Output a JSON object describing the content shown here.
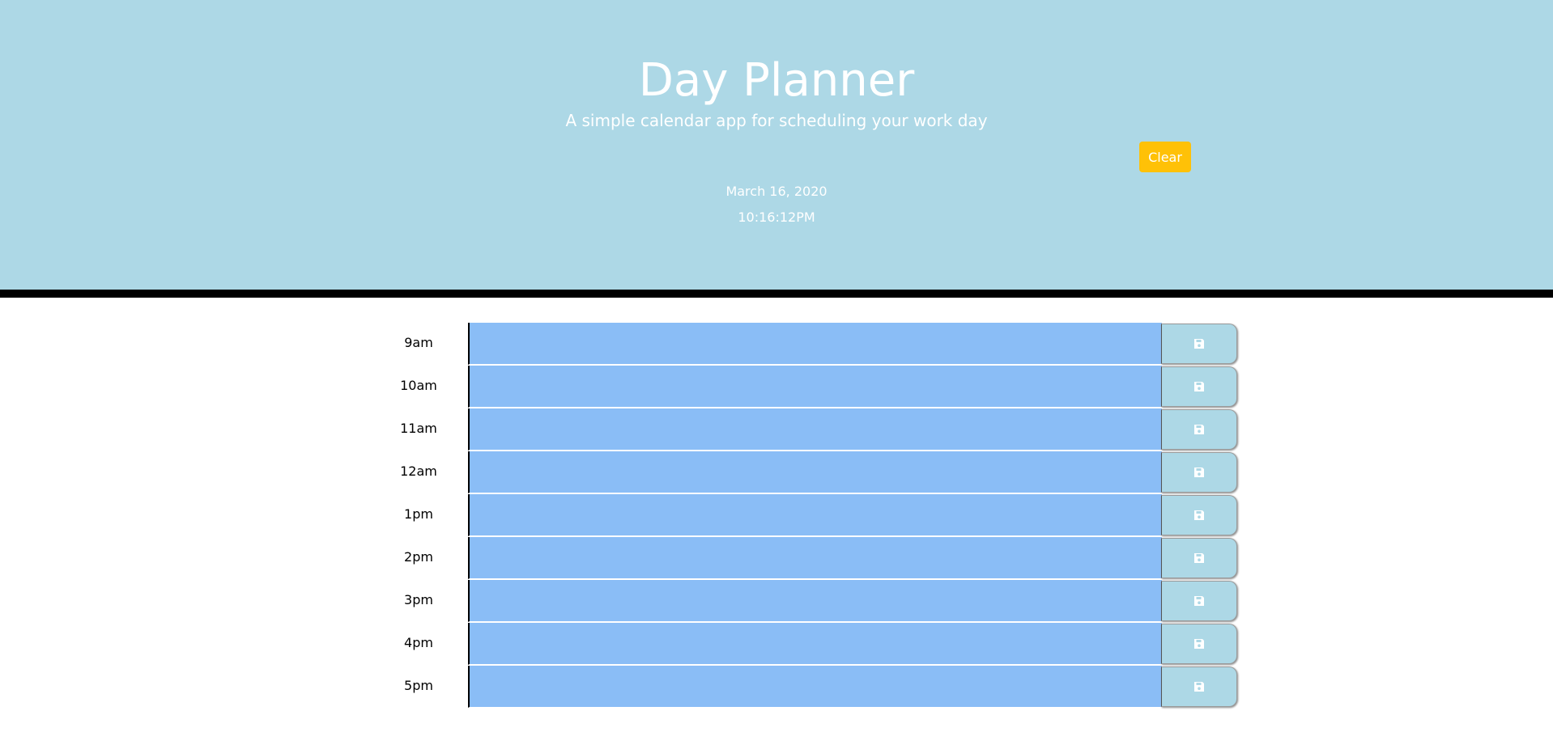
{
  "header": {
    "title": "Day Planner",
    "subtitle": "A simple calendar app for scheduling your work day",
    "clear_label": "Clear",
    "date": "March 16, 2020",
    "time": "10:16:12PM"
  },
  "colors": {
    "header_bg": "#add8e6",
    "clear_button": "#ffc107",
    "time_block": "#8abdf6",
    "save_button": "#add8e6",
    "divider": "#000000"
  },
  "icons": {
    "save": "floppy-disk-icon"
  },
  "planner": {
    "rows": [
      {
        "hour": "9am",
        "text": ""
      },
      {
        "hour": "10am",
        "text": ""
      },
      {
        "hour": "11am",
        "text": ""
      },
      {
        "hour": "12am",
        "text": ""
      },
      {
        "hour": "1pm",
        "text": ""
      },
      {
        "hour": "2pm",
        "text": ""
      },
      {
        "hour": "3pm",
        "text": ""
      },
      {
        "hour": "4pm",
        "text": ""
      },
      {
        "hour": "5pm",
        "text": ""
      }
    ]
  }
}
